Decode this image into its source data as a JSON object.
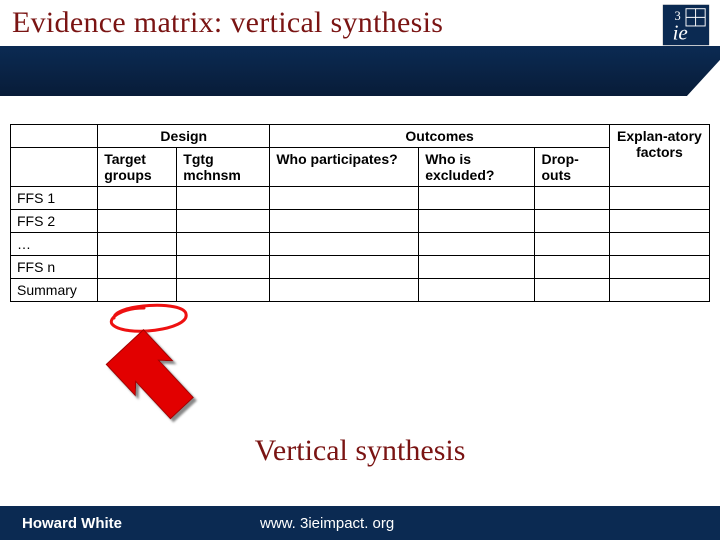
{
  "header": {
    "title": "Evidence matrix: vertical synthesis",
    "logo_name": "3ie-logo"
  },
  "table": {
    "group_headers": {
      "design": "Design",
      "outcomes": "Outcomes"
    },
    "columns": {
      "target_groups": "Target groups",
      "tgtg_mchnsm": "Tgtg mchnsm",
      "who_participates": "Who participates?",
      "who_excluded": "Who is excluded?",
      "dropouts": "Drop-outs",
      "explan_factors": "Explan-atory factors"
    },
    "rows": [
      "FFS 1",
      "FFS 2",
      "…",
      "FFS n",
      "Summary"
    ]
  },
  "mid_title": "Vertical synthesis",
  "footer": {
    "author": "Howard White",
    "url": "www. 3ieimpact. org"
  }
}
